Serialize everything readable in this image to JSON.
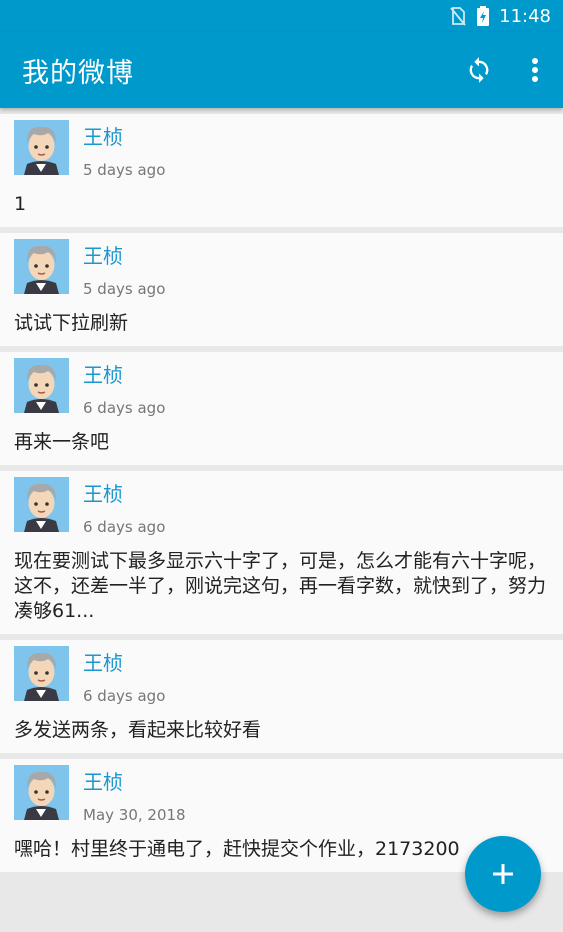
{
  "status_bar": {
    "time": "11:48",
    "icons": [
      "no-sim-icon",
      "battery-charging-icon"
    ]
  },
  "app_bar": {
    "title": "我的微博",
    "actions": [
      "refresh-icon",
      "overflow-menu-icon"
    ]
  },
  "posts": [
    {
      "author": "王桢",
      "time": "5 days ago",
      "text": "1"
    },
    {
      "author": "王桢",
      "time": "5 days ago",
      "text": "试试下拉刷新"
    },
    {
      "author": "王桢",
      "time": "6 days ago",
      "text": "再来一条吧"
    },
    {
      "author": "王桢",
      "time": "6 days ago",
      "text": "现在要测试下最多显示六十字了，可是，怎么才能有六十字呢，这不，还差一半了，刚说完这句，再一看字数，就快到了，努力凑够61..."
    },
    {
      "author": "王桢",
      "time": "6 days ago",
      "text": "多发送两条，看起来比较好看"
    },
    {
      "author": "王桢",
      "time": "May 30, 2018",
      "text": "嘿哈！村里终于通电了，赶快提交个作业，2173200"
    }
  ],
  "fab": {
    "icon": "add-icon"
  },
  "colors": {
    "primary": "#0099cc",
    "name": "#1a97cf",
    "avatar_bg": "#7fc4ec"
  }
}
